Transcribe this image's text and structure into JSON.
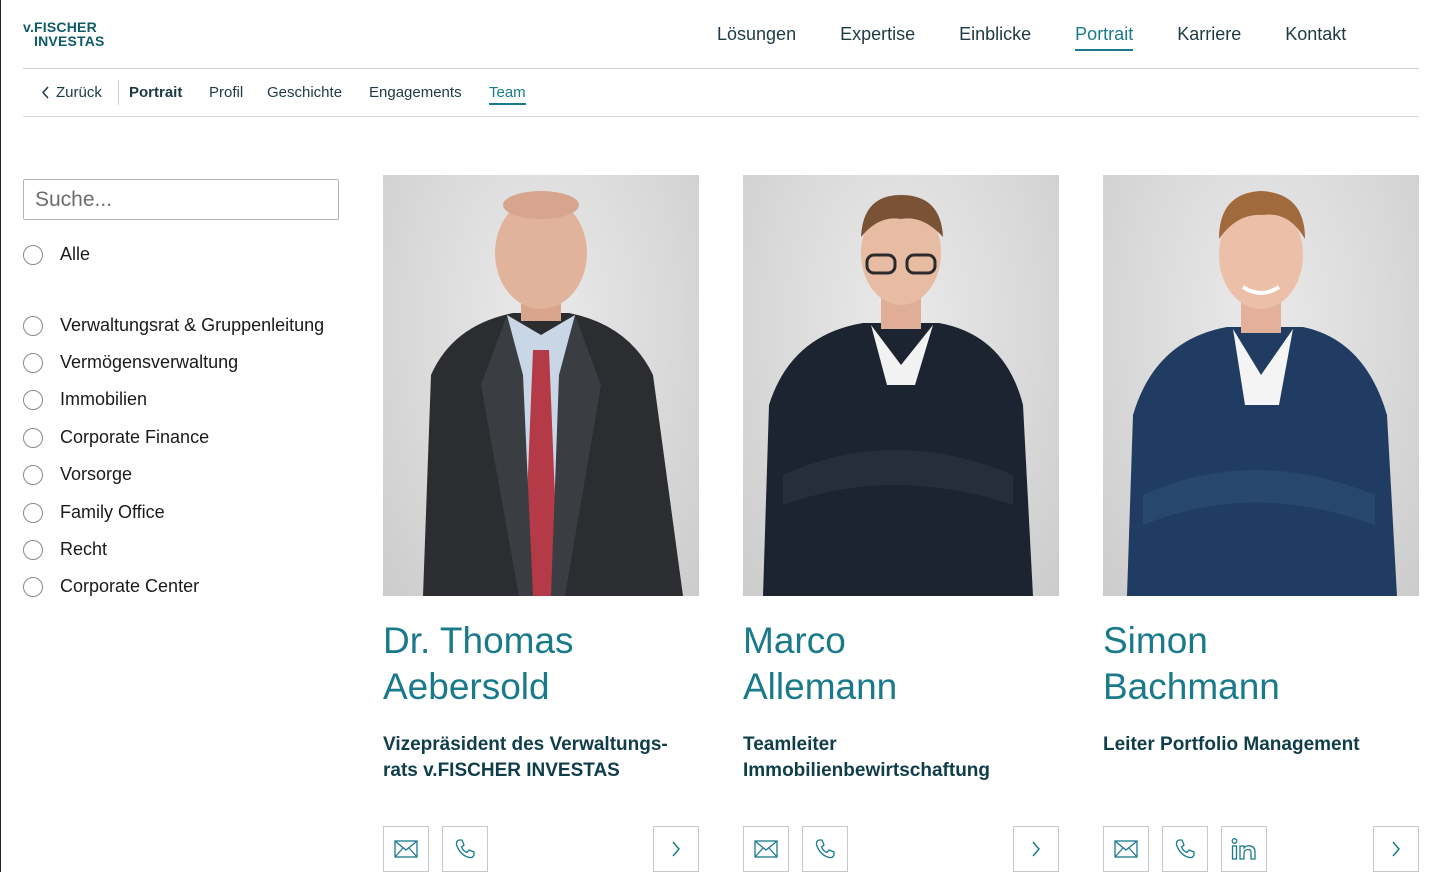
{
  "brand": {
    "logo_line1": "v.FISCHER",
    "logo_line2": "INVESTAS"
  },
  "mainnav": {
    "items": [
      "Lösungen",
      "Expertise",
      "Einblicke",
      "Portrait",
      "Karriere",
      "Kontakt"
    ],
    "active": "Portrait"
  },
  "subnav": {
    "back_label": "Zurück",
    "section": "Portrait",
    "items": [
      "Profil",
      "Geschichte",
      "Engagements",
      "Team"
    ],
    "active": "Team"
  },
  "sidebar": {
    "search_placeholder": "Suche...",
    "filters": [
      "Alle",
      "Verwaltungsrat & Gruppenleitung",
      "Vermögensverwaltung",
      "Immobilien",
      "Corporate Finance",
      "Vorsorge",
      "Family Office",
      "Recht",
      "Corporate Center"
    ]
  },
  "team": [
    {
      "first": "Dr. Thomas",
      "last": "Aebersold",
      "role_line1": "Vizepräsident des Verwaltungs-",
      "role_line2": "rats v.FISCHER INVESTAS",
      "actions": [
        "mail-icon",
        "phone-icon"
      ]
    },
    {
      "first": "Marco",
      "last": "Allemann",
      "role_line1": "Teamleiter",
      "role_line2": "Immobilienbewirtschaftung",
      "actions": [
        "mail-icon",
        "phone-icon"
      ]
    },
    {
      "first": "Simon",
      "last": "Bachmann",
      "role_line1": "Leiter Portfolio Management",
      "role_line2": "",
      "actions": [
        "mail-icon",
        "phone-icon",
        "linkedin-icon"
      ]
    }
  ],
  "colors": {
    "accent": "#1a7a8c",
    "dark_teal": "#0f3d4a",
    "logo": "#0f5b6a"
  }
}
